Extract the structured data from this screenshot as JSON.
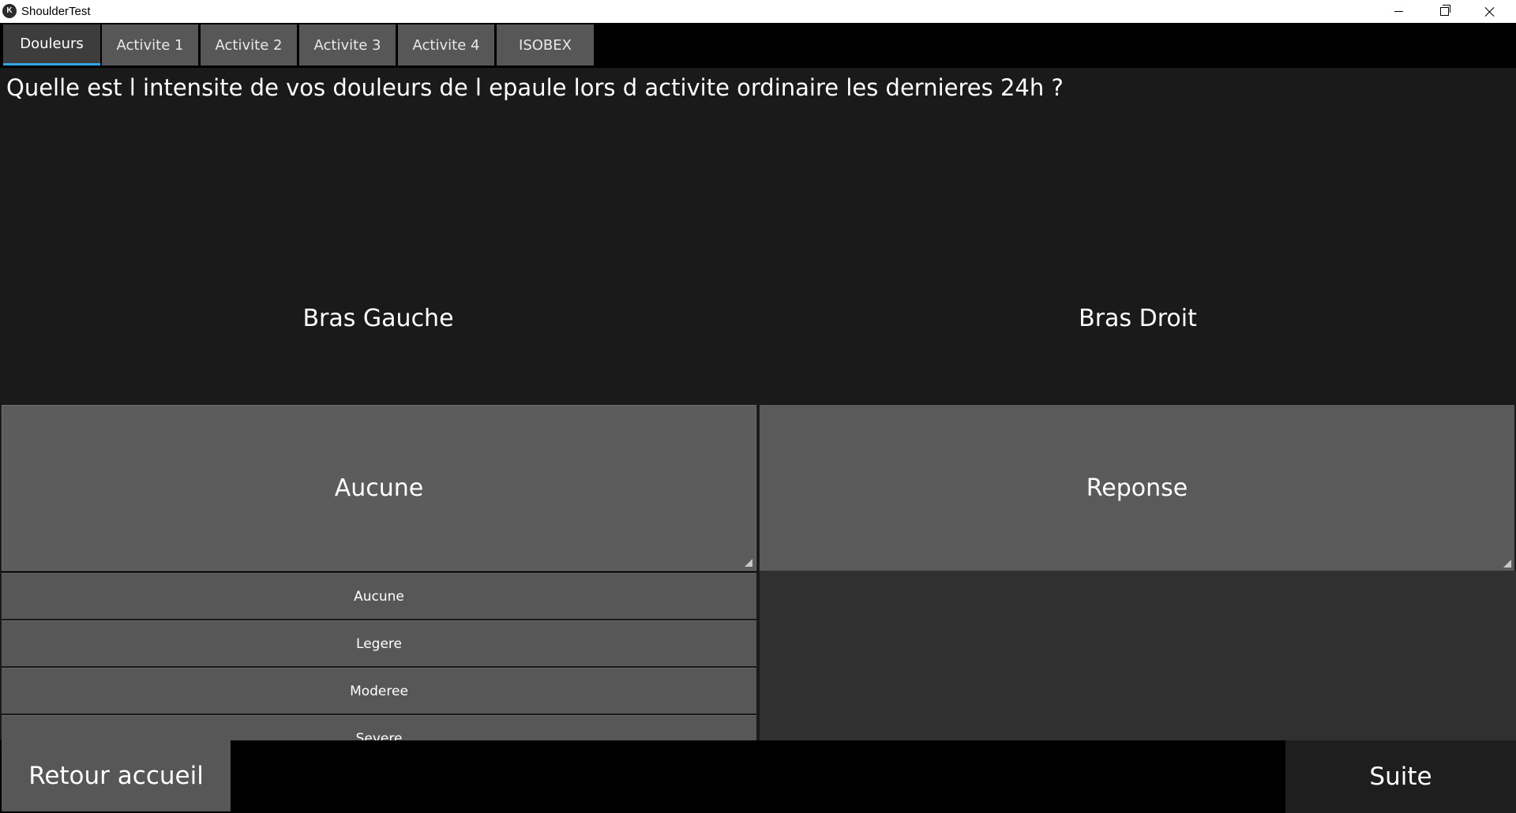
{
  "window": {
    "icon_letter": "K",
    "title": "ShoulderTest"
  },
  "tabs": [
    {
      "label": "Douleurs",
      "active": true
    },
    {
      "label": "Activite 1",
      "active": false
    },
    {
      "label": "Activite 2",
      "active": false
    },
    {
      "label": "Activite 3",
      "active": false
    },
    {
      "label": "Activite 4",
      "active": false
    },
    {
      "label": "ISOBEX",
      "active": false
    }
  ],
  "main": {
    "question": "Quelle est l intensite de vos douleurs de l epaule lors d activite ordinaire les dernieres 24h ?",
    "left_label": "Bras Gauche",
    "right_label": "Bras Droit",
    "left_spinner_value": "Aucune",
    "right_spinner_value": "Reponse",
    "options": [
      "Aucune",
      "Legere",
      "Moderee",
      "Severe"
    ]
  },
  "bottom": {
    "back_label": "Retour accueil",
    "next_label": "Suite"
  },
  "colors": {
    "accent": "#33a5e5",
    "button": "#575757",
    "panel": "#1a1a1a"
  }
}
